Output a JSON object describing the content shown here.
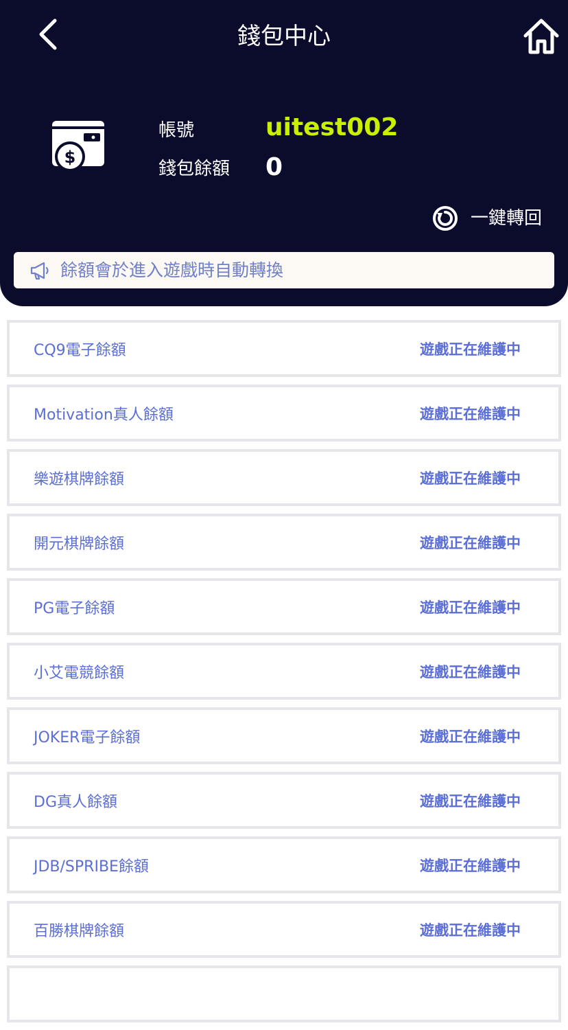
{
  "header": {
    "title": "錢包中心",
    "back_icon": "chevron-left-icon",
    "home_icon": "home-icon"
  },
  "account": {
    "account_label": "帳號",
    "account_value": "uitest002",
    "balance_label": "錢包餘額",
    "balance_value": "0",
    "wallet_icon": "wallet-icon"
  },
  "transfer": {
    "label": "一鍵轉回",
    "icon": "refresh-icon"
  },
  "notice": {
    "icon": "megaphone-icon",
    "text": "餘額會於進入遊戲時自動轉換"
  },
  "games": [
    {
      "name": "CQ9電子餘額",
      "status": "遊戲正在維護中"
    },
    {
      "name": "Motivation真人餘額",
      "status": "遊戲正在維護中"
    },
    {
      "name": "樂遊棋牌餘額",
      "status": "遊戲正在維護中"
    },
    {
      "name": "開元棋牌餘額",
      "status": "遊戲正在維護中"
    },
    {
      "name": "PG電子餘額",
      "status": "遊戲正在維護中"
    },
    {
      "name": "小艾電競餘額",
      "status": "遊戲正在維護中"
    },
    {
      "name": "JOKER電子餘額",
      "status": "遊戲正在維護中"
    },
    {
      "name": "DG真人餘額",
      "status": "遊戲正在維護中"
    },
    {
      "name": "JDB/SPRIBE餘額",
      "status": "遊戲正在維護中"
    },
    {
      "name": "百勝棋牌餘額",
      "status": "遊戲正在維護中"
    }
  ],
  "colors": {
    "header_bg": "#0b0c2c",
    "account_accent": "#c8f000",
    "list_text": "#5b6ed6",
    "notice_bg": "#fcf8f4"
  }
}
